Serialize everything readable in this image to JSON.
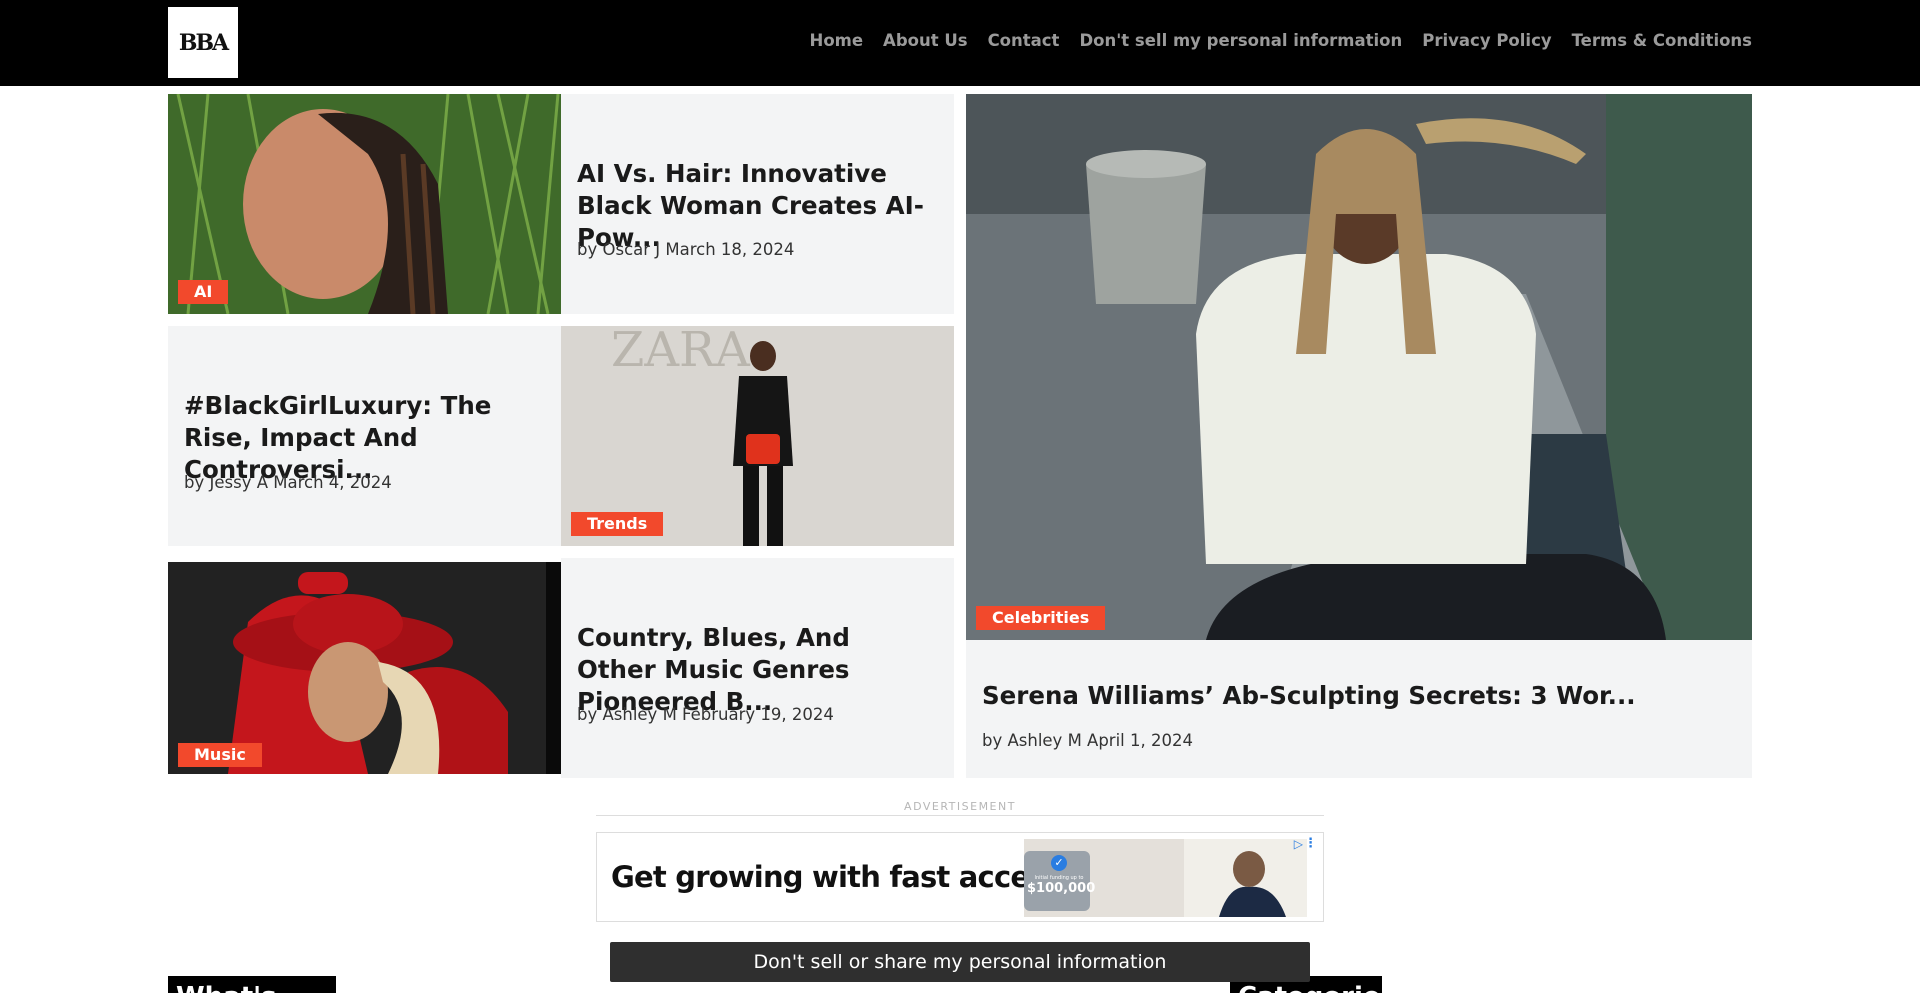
{
  "site": {
    "logo_text": "BBA"
  },
  "nav": [
    {
      "label": "Home"
    },
    {
      "label": "About Us"
    },
    {
      "label": "Contact"
    },
    {
      "label": "Don't sell my personal information"
    },
    {
      "label": "Privacy Policy"
    },
    {
      "label": "Terms & Conditions"
    }
  ],
  "articles": [
    {
      "category": "AI",
      "title": "AI Vs. Hair: Innovative Black Woman Creates AI-Pow...",
      "byline": "by Oscar J March 18, 2024"
    },
    {
      "category": "Trends",
      "title": "#BlackGirlLuxury: The Rise, Impact And Controversi...",
      "byline": "by Jessy A March 4, 2024"
    },
    {
      "category": "Music",
      "title": "Country, Blues, And Other Music Genres Pioneered B...",
      "byline": "by Ashley M February 19, 2024"
    },
    {
      "category": "Celebrities",
      "title": "Serena Williams’ Ab-Sculpting Secrets: 3 Wor...",
      "byline": "by Ashley M April 1, 2024"
    }
  ],
  "ad": {
    "label": "ADVERTISEMENT",
    "headline": "Get growing with fast access",
    "amount": "$100,000",
    "small_text": "Initial funding up to"
  },
  "dns_bar": {
    "label": "Don't sell or share my personal information"
  },
  "sections": [
    {
      "label": "What's New"
    },
    {
      "label": "Categories"
    }
  ],
  "colors": {
    "accent": "#f2492c",
    "header_bg": "#000000",
    "card_bg": "#f3f4f5"
  }
}
